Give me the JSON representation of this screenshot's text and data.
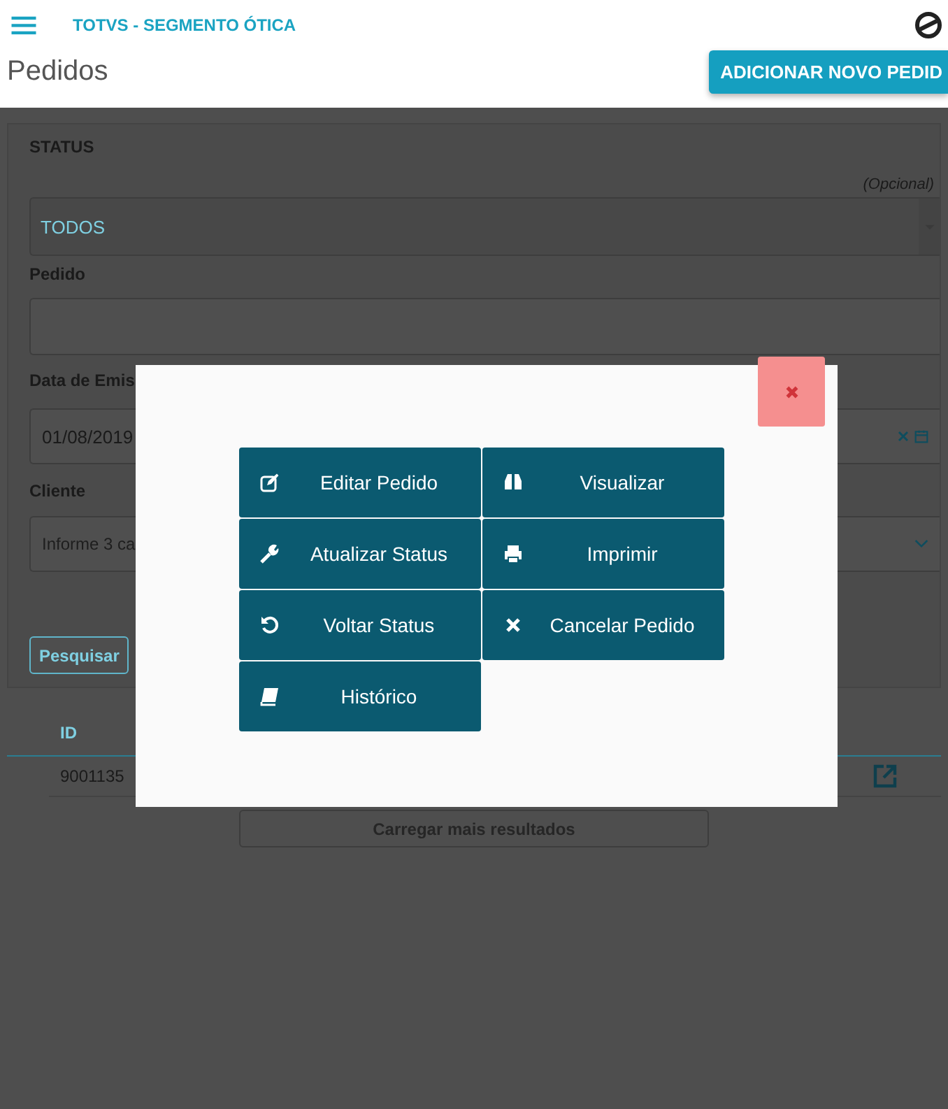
{
  "header": {
    "app_title": "TOTVS - SEGMENTO ÓTICA",
    "page_title": "Pedidos",
    "add_button": "ADICIONAR NOVO PEDID"
  },
  "filters": {
    "status_label": "STATUS",
    "optional_hint": "(Opcional)",
    "status_value": "TODOS",
    "order_label": "Pedido",
    "date_label": "Data de Emis",
    "date_value": "01/08/2019",
    "client_label": "Cliente",
    "client_placeholder": "Informe 3 ca",
    "search_button": "Pesquisar"
  },
  "table": {
    "columns": [
      "ID"
    ],
    "rows": [
      {
        "id": "9001135"
      }
    ]
  },
  "load_more": "Carregar mais resultados",
  "modal": {
    "actions": [
      {
        "kind": "edit",
        "label": "Editar Pedido"
      },
      {
        "kind": "view",
        "label": "Visualizar"
      },
      {
        "kind": "status",
        "label": "Atualizar Status"
      },
      {
        "kind": "print",
        "label": "Imprimir"
      },
      {
        "kind": "revert",
        "label": "Voltar Status"
      },
      {
        "kind": "cancel",
        "label": "Cancelar Pedido"
      },
      {
        "kind": "history",
        "label": "Histórico"
      }
    ]
  }
}
